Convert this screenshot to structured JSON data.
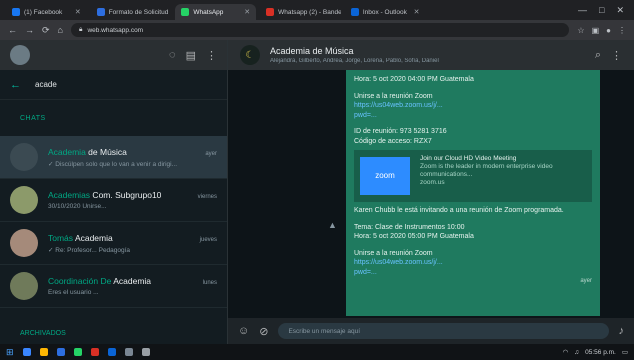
{
  "browser": {
    "tabs": [
      {
        "label": "(1) Facebook",
        "color": "#1877f2",
        "active": false
      },
      {
        "label": "Formato de Solicitud",
        "color": "#2d6ee0",
        "active": false
      },
      {
        "label": "WhatsApp",
        "color": "#25d366",
        "active": true
      },
      {
        "label": "Whatsapp (2) - Bandeja",
        "color": "#d93025",
        "active": false
      },
      {
        "label": "Inbox - Outlook",
        "color": "#0a64d6",
        "active": false
      }
    ],
    "url": "web.whatsapp.com",
    "window_controls": [
      "—",
      "□",
      "✕"
    ]
  },
  "sidebar": {
    "search_value": "acade",
    "section_label": "CHATS",
    "chats": [
      {
        "name_hl": "Academia",
        "name_rest": " de Música",
        "time": "ayer",
        "preview": "✓ Discúlpen solo que lo van a venir a dirigi...",
        "avatar_color": "#3b4a52",
        "selected": true
      },
      {
        "name_hl": "Academias",
        "name_rest": " Com. Subgrupo10",
        "time": "viernes",
        "preview": "30/10/2020 Unirse...",
        "avatar_color": "#8c9a6a",
        "selected": false
      },
      {
        "name_hl": "Tomás ",
        "name_rest": "Academia",
        "time": "jueves",
        "preview": "✓ Re: Profesor... Pedagogía",
        "avatar_color": "#a58a7a",
        "selected": false
      },
      {
        "name_hl": "Coordinación De ",
        "name_rest": "Academia",
        "time": "lunes",
        "preview": "Eres el usuario ...",
        "avatar_color": "#6f7a5a",
        "selected": false
      }
    ],
    "archived_label": "ARCHIVADOS"
  },
  "conversation": {
    "title": "Academia de Música",
    "members": "Alejandra, Gilberto, Andrea, Jorge, Lorena, Pablo, Sofía, Daniel",
    "messages": {
      "line1": "Hora: 5 oct 2020 04:00 PM Guatemala",
      "join_label": "Unirse a la reunión Zoom",
      "link1": "https://us04web.zoom.us/j/...",
      "link2": "pwd=...",
      "meeting_id": "ID de reunión: 973 5281 3716",
      "access_code": "Código de acceso: RZX7",
      "preview_logo": "zoom",
      "preview_title": "Join our Cloud HD Video Meeting",
      "preview_desc": "Zoom is the leader in modern enterprise video communications...",
      "preview_domain": "zoom.us",
      "invite": "Karen Chubb le está invitando a una reunión de Zoom programada.",
      "topic": "Tema: Clase de Instrumentos 10:00",
      "time2": "Hora: 5 oct 2020 05:00 PM Guatemala",
      "join_label2": "Unirse a la reunión Zoom",
      "link3": "https://us04web.zoom.us/j/...",
      "link4": "pwd=...",
      "meta": "ayer"
    },
    "composer_placeholder": "Escribe un mensaje aquí"
  },
  "taskbar": {
    "apps": [
      "#3a86ff",
      "#ffb703",
      "#2d6ee0",
      "#25d366",
      "#d93025",
      "#0a64d6",
      "#7b8794",
      "#9aa0a6"
    ],
    "time": "05:56 p.m."
  }
}
